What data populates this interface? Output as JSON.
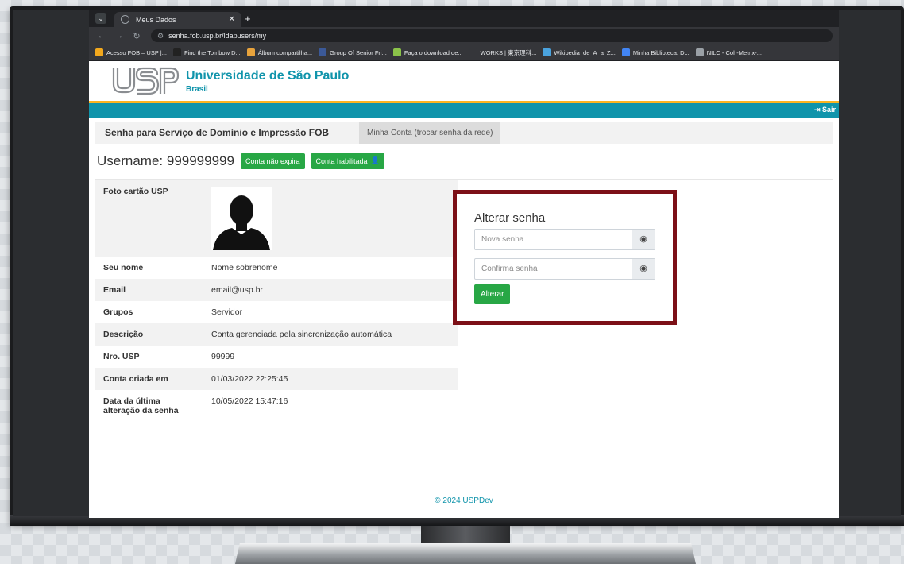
{
  "browser": {
    "tab_title": "Meus Dados",
    "url": "senha.fob.usp.br/ldapusers/my",
    "bookmarks": [
      {
        "label": "Acesso FOB – USP |...",
        "color": "#f2a81d"
      },
      {
        "label": "Find the Tombow D...",
        "color": "#222222"
      },
      {
        "label": "Álbum compartilha...",
        "color": "#e8a33c"
      },
      {
        "label": "Group Of Senior Fri...",
        "color": "#3b5998"
      },
      {
        "label": "Faça o download de...",
        "color": "#8bc34a"
      },
      {
        "label": "WORKS | 東京理科...",
        "color": "#35363a"
      },
      {
        "label": "Wikipedia_de_A_a_Z...",
        "color": "#4aa3df"
      },
      {
        "label": "Minha Biblioteca: D...",
        "color": "#4285f4"
      },
      {
        "label": "NILC - Coh-Metrix-...",
        "color": "#9aa0a6"
      }
    ]
  },
  "header": {
    "logo_text": "USP",
    "university": "Universidade de São Paulo",
    "country": "Brasil",
    "logout": "Sair"
  },
  "tabs": {
    "active": "Senha para Serviço de Domínio e Impressão FOB",
    "other": "Minha Conta (trocar senha da rede)"
  },
  "user": {
    "username_label": "Username: 999999999",
    "badge_expire": "Conta não expira",
    "badge_enabled": "Conta habilitada"
  },
  "info": {
    "photo_label": "Foto cartão USP",
    "rows": [
      {
        "k": "Seu nome",
        "v": "Nome sobrenome"
      },
      {
        "k": "Email",
        "v": "email@usp.br"
      },
      {
        "k": "Grupos",
        "v": "Servidor"
      },
      {
        "k": "Descrição",
        "v": "Conta gerenciada pela sincronização automática"
      },
      {
        "k": "Nro. USP",
        "v": "99999"
      },
      {
        "k": "Conta criada em",
        "v": "01/03/2022 22:25:45"
      },
      {
        "k": "Data da última alteração da senha",
        "v": "10/05/2022 15:47:16"
      }
    ]
  },
  "password_form": {
    "title": "Alterar senha",
    "new_placeholder": "Nova senha",
    "confirm_placeholder": "Confirma senha",
    "submit": "Alterar"
  },
  "footer": "© 2024 USPDev",
  "colors": {
    "brand": "#1094ab",
    "gold": "#fcb421",
    "success": "#28a745",
    "highlight": "#7c1017"
  }
}
